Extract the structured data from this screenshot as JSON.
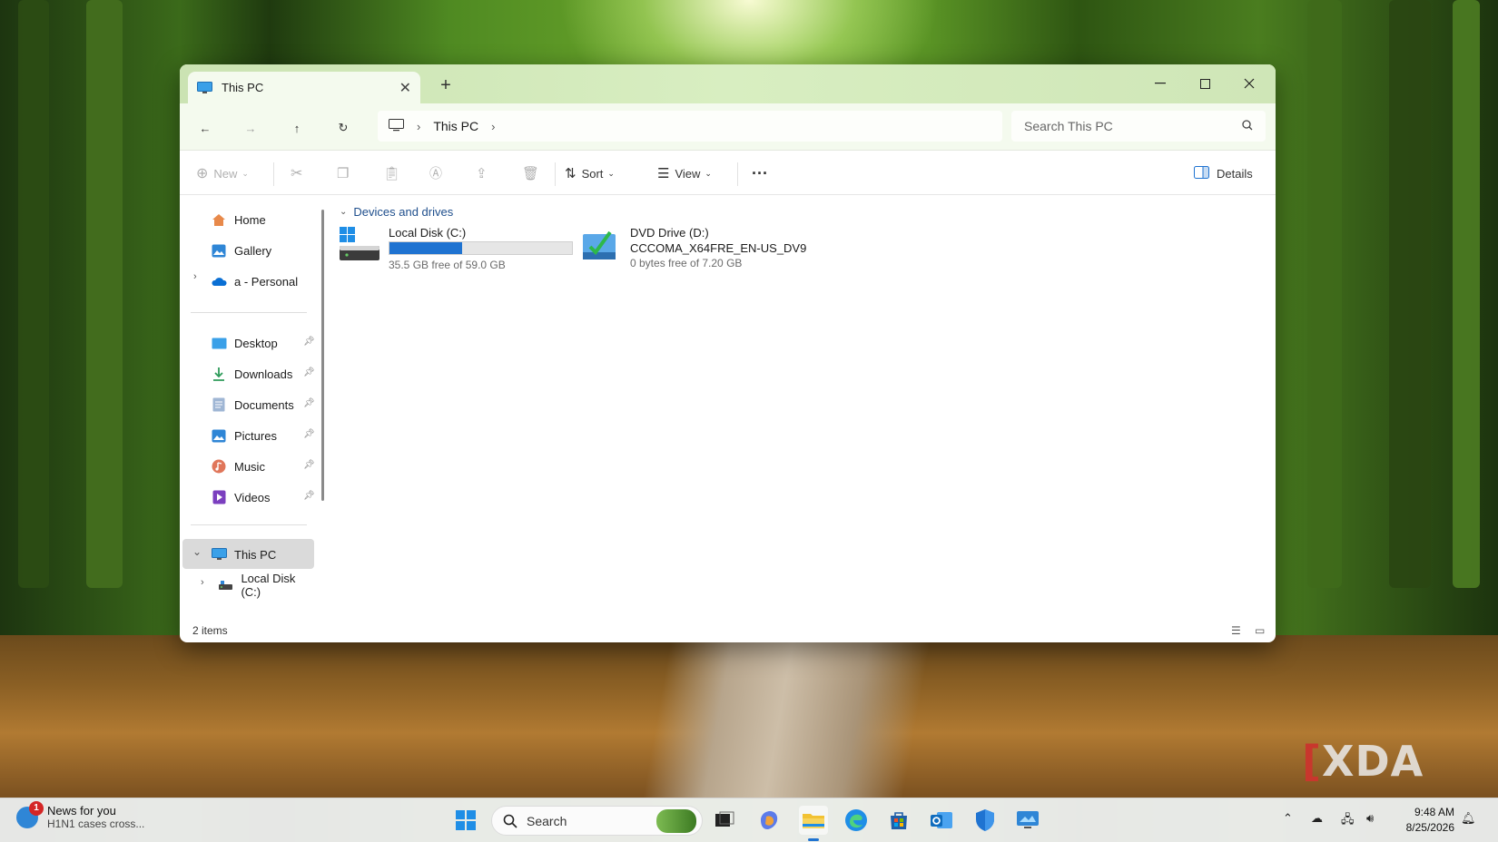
{
  "window": {
    "tab_title": "This PC",
    "breadcrumb": [
      "This PC"
    ],
    "search_placeholder": "Search This PC"
  },
  "toolbar": {
    "new_label": "New",
    "sort_label": "Sort",
    "view_label": "View",
    "details_label": "Details"
  },
  "sidebar": {
    "top": [
      {
        "label": "Home",
        "icon": "home-icon"
      },
      {
        "label": "Gallery",
        "icon": "gallery-icon"
      },
      {
        "label": "a - Personal",
        "icon": "onedrive-cloud-icon"
      }
    ],
    "pinned": [
      {
        "label": "Desktop",
        "icon": "desktop-icon"
      },
      {
        "label": "Downloads",
        "icon": "downloads-icon"
      },
      {
        "label": "Documents",
        "icon": "documents-icon"
      },
      {
        "label": "Pictures",
        "icon": "pictures-icon"
      },
      {
        "label": "Music",
        "icon": "music-icon"
      },
      {
        "label": "Videos",
        "icon": "videos-icon"
      }
    ],
    "this_pc": "This PC",
    "local_disk": "Local Disk (C:)"
  },
  "content": {
    "group_title": "Devices and drives",
    "drives": [
      {
        "name": "Local Disk (C:)",
        "free_text": "35.5 GB free of 59.0 GB",
        "used_fraction": 0.4
      },
      {
        "name": "DVD Drive (D:)",
        "label": "CCCOMA_X64FRE_EN-US_DV9",
        "free_text": "0 bytes free of 7.20 GB"
      }
    ]
  },
  "status": {
    "item_count": "2 items"
  },
  "taskbar": {
    "news_title": "News for you",
    "news_subtitle": "H1N1 cases cross...",
    "news_badge": "1",
    "search_label": "Search",
    "time": "9:48 AM",
    "date": "8/25/2026"
  },
  "watermark": "XDA",
  "colors": {
    "accent": "#1f73d1",
    "titlebar": "#d8eec1",
    "link": "#1e4e8c"
  }
}
